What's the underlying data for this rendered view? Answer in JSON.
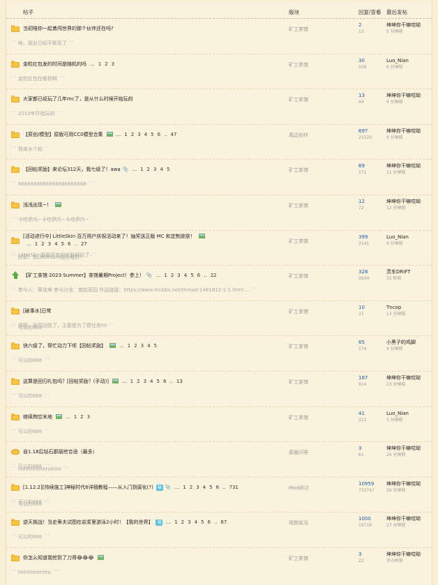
{
  "header": {
    "topic": "帖子",
    "forum": "版块",
    "stats": "回复/查看",
    "last_post": "最后发帖"
  },
  "threads": [
    {
      "icon": "folder",
      "title": "当初陪你一起勇闯世界的那个伙伴还在吗?",
      "pages": [],
      "forum": "矿工茶馆",
      "replies": "2",
      "views": "12",
      "last_user": "坤坤你干嘛哎呦",
      "last_time": "5 分钟前",
      "preview": "唉，朋友已经不联系了"
    },
    {
      "icon": "folder",
      "title": "金粒红包发的时间是随机的吗",
      "pages": [
        "1",
        "2",
        "3"
      ],
      "ellipsis": "...",
      "forum": "矿工茶馆",
      "replies": "30",
      "views": "109",
      "last_user": "Luo_Nian",
      "last_time": "6 分钟前",
      "preview": "金粒红包在哪抢啊"
    },
    {
      "icon": "folder",
      "title": "大家都已经玩了几年mc了，是从什么时候开始玩的",
      "pages": [],
      "forum": "矿工茶馆",
      "replies": "13",
      "views": "44",
      "last_user": "坤坤你干嘛哎呦",
      "last_time": "6 分钟前",
      "preview": "2010年开始玩的"
    },
    {
      "icon": "folder",
      "title": "【原创/模型】原版可用CC0模型合集",
      "img": true,
      "pages": [
        "1",
        "2",
        "3",
        "4",
        "5",
        "6",
        "47"
      ],
      "ellipsis": "...",
      "dots": "..",
      "forum": "周边创作",
      "replies": "697",
      "views": "21529",
      "last_user": "坤坤你干嘛哎呦",
      "last_time": "9 分钟前",
      "preview": "我来水个帖"
    },
    {
      "icon": "folder",
      "title": "【回帖奖励】来论坛312天，我七级了！awa",
      "att": true,
      "pages": [
        "1",
        "2",
        "3",
        "4",
        "5"
      ],
      "ellipsis": "...",
      "forum": "矿工茶馆",
      "replies": "69",
      "views": "271",
      "last_user": "坤坤你干嘛哎呦",
      "last_time": "11 分钟前",
      "preview": "6666666666666666666666"
    },
    {
      "icon": "folder",
      "title": "浅浅出现~！",
      "img": true,
      "pages": [],
      "forum": "矿工茶馆",
      "replies": "12",
      "views": "72",
      "last_user": "坤坤你干嘛哎呦",
      "last_time": "12 分钟前",
      "preview": "卡哇伊内~卡哇伊内~卡哇伊内~"
    },
    {
      "icon": "folder",
      "title": "[活动进行中] LittleSkin 百万用户庆祝活动来了！抽奖送正版 MC 和定制皮肤！",
      "img": true,
      "wrap": true,
      "pages": [
        "1",
        "2",
        "3",
        "4",
        "5",
        "6",
        "27"
      ],
      "ellipsis": "...",
      "dots": "..",
      "forum": "矿工茶馆",
      "replies": "399",
      "views": "2141",
      "last_user": "Luo_Nian",
      "last_time": "9 分钟前",
      "preview": "LittleSkin是最厉害的皮肤网站了"
    },
    {
      "icon": "up",
      "title": "【矿工茶馆·2023·Summer】茶馆暑期Project！参上！",
      "att": true,
      "pages": [
        "1",
        "2",
        "3",
        "4",
        "5",
        "6",
        "22"
      ],
      "ellipsis": "...",
      "dots": "..",
      "forum": "矿工茶馆",
      "replies": "328",
      "views": "3934",
      "last_user": "灵车DRIFT",
      "last_time": "35 秒前",
      "preview_top": "好耶！祝LittleSkin越办越好！",
      "preview": "参与人：蔡徐坤 参与分支：筑起家园 作品链接：https://www.mcbbs.net/thread-1461812-1-1.html ..."
    },
    {
      "icon": "folder",
      "title": "[破事水]日常",
      "pages": [],
      "forum": "矿工茶馆",
      "replies": "10",
      "views": "21",
      "last_user": "Tncop",
      "last_time": "13 分钟前",
      "preview": "烦嗯，居然回我了，主要是为了攒任务hh"
    },
    {
      "icon": "folder",
      "title": "快六级了，帮忙动力下呗【回帖奖励】",
      "img": true,
      "pages": [
        "1",
        "2",
        "3",
        "4",
        "5"
      ],
      "ellipsis": "...",
      "forum": "矿工茶馆",
      "replies": "65",
      "views": "174",
      "last_user": "小黑子的鸡脚",
      "last_time": "9 分钟前",
      "preview_top": "可以的666",
      "preview": "可以的666"
    },
    {
      "icon": "folder",
      "title": "这算是回归礼包吗？[回帖奖励？(手动)]",
      "img": true,
      "pages": [
        "1",
        "2",
        "3",
        "4",
        "5",
        "6",
        "13"
      ],
      "ellipsis": "...",
      "dots": "..",
      "forum": "矿工茶馆",
      "replies": "187",
      "views": "914",
      "last_user": "坤坤你干嘛哎呦",
      "last_time": "23 分钟前",
      "preview": "可以的666"
    },
    {
      "icon": "folder",
      "title": "继续掏空末地",
      "img": true,
      "pages": [
        "1",
        "2",
        "3"
      ],
      "ellipsis": "...",
      "forum": "矿工茶馆",
      "replies": "41",
      "views": "212",
      "last_user": "Luo_Nian",
      "last_time": "5 分钟前",
      "preview": "可以的666"
    },
    {
      "icon": "qa",
      "title": "自1.18后钻石那层挖合适（最多）",
      "pages": [],
      "forum": "原版问答",
      "replies": "3",
      "views": "61",
      "last_user": "坤坤你干嘛哎呦",
      "last_time": "26 分钟前",
      "preview": "可以的666"
    },
    {
      "icon": "folder",
      "title": "[1.12.2][持续施工]神秘时代6详细教程——从入门到腐化(?)",
      "badge": "秘",
      "att": true,
      "pages": [
        "1",
        "2",
        "3",
        "4",
        "5",
        "6",
        "731"
      ],
      "ellipsis": "...",
      "dots": "..",
      "forum": "Mod研讨",
      "replies": "10959",
      "views": "755747",
      "last_user": "坤坤你干嘛哎呦",
      "last_time": "26 分钟前",
      "preview_top": "hhhhhhhhhhhhhh",
      "preview": "可以的666"
    },
    {
      "icon": "folder",
      "title": "逆天挑战！当史蒂夫试图在岩浆里游泳2小时！【我的世界】",
      "badge": "视",
      "pages": [
        "1",
        "2",
        "3",
        "4",
        "5",
        "6",
        "67"
      ],
      "ellipsis": "...",
      "dots": "..",
      "forum": "视频实况",
      "replies": "1000",
      "views": "18716",
      "last_user": "坤坤你干嘛哎呦",
      "last_time": "27 分钟前",
      "preview_top": "可以的666",
      "preview": "可以的666"
    },
    {
      "icon": "folder",
      "title": "你怎么知道我挖到了刀哥😂😂😂",
      "img": true,
      "pages": [],
      "forum": "矿工茶馆",
      "replies": "3",
      "views": "22",
      "last_user": "坤坤你干嘛哎呦",
      "last_time": "半小时前",
      "preview": "hhhhhhhhhhc"
    }
  ]
}
